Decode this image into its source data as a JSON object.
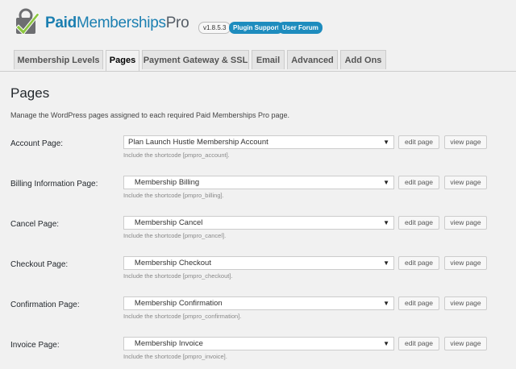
{
  "header": {
    "brand_paid": "Paid",
    "brand_memberships": "Memberships",
    "brand_pro": "Pro",
    "version": "v1.8.5.3",
    "support_label": "Plugin Support",
    "forum_label": "User Forum",
    "accent_color": "#1e8cbe"
  },
  "tabs": [
    {
      "label": "Membership Levels",
      "active": false
    },
    {
      "label": "Pages",
      "active": true
    },
    {
      "label": "Payment Gateway & SSL",
      "active": false
    },
    {
      "label": "Email",
      "active": false
    },
    {
      "label": "Advanced",
      "active": false
    },
    {
      "label": "Add Ons",
      "active": false
    }
  ],
  "page": {
    "title": "Pages",
    "description": "Manage the WordPress pages assigned to each required Paid Memberships Pro page."
  },
  "buttons": {
    "edit": "edit page",
    "view": "view page"
  },
  "rows": [
    {
      "label": "Account Page:",
      "value": "Plan Launch Hustle Membership Account",
      "hint": "Include the shortcode [pmpro_account]."
    },
    {
      "label": "Billing Information Page:",
      "value": "   Membership Billing",
      "hint": "Include the shortcode [pmpro_billing]."
    },
    {
      "label": "Cancel Page:",
      "value": "   Membership Cancel",
      "hint": "Include the shortcode [pmpro_cancel]."
    },
    {
      "label": "Checkout Page:",
      "value": "   Membership Checkout",
      "hint": "Include the shortcode [pmpro_checkout]."
    },
    {
      "label": "Confirmation Page:",
      "value": "   Membership Confirmation",
      "hint": "Include the shortcode [pmpro_confirmation]."
    },
    {
      "label": "Invoice Page:",
      "value": "   Membership Invoice",
      "hint": "Include the shortcode [pmpro_invoice]."
    }
  ]
}
